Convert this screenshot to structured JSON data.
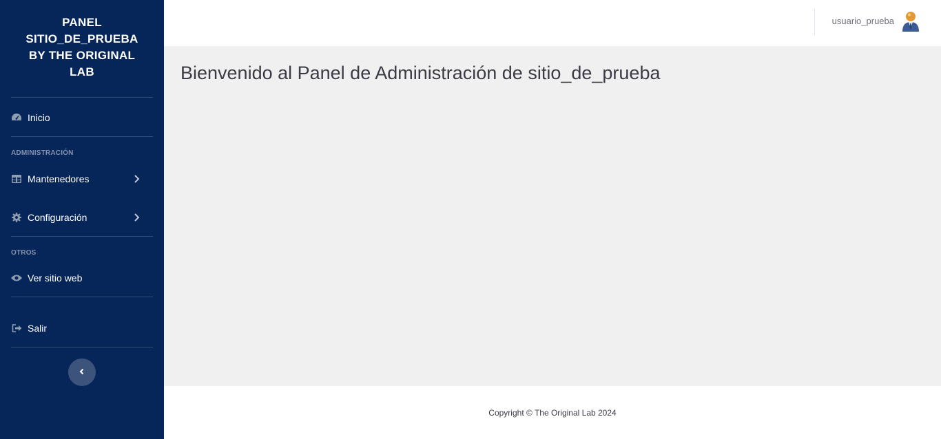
{
  "sidebar": {
    "brand": "PANEL SITIO_DE_PRUEBA BY THE ORIGINAL LAB",
    "items": {
      "inicio": {
        "label": "Inicio",
        "icon": "tachometer-icon"
      },
      "mantenedores": {
        "label": "Mantenedores",
        "icon": "table-icon"
      },
      "configuracion": {
        "label": "Configuración",
        "icon": "gear-icon"
      },
      "ver_sitio": {
        "label": "Ver sitio web",
        "icon": "eye-icon"
      },
      "salir": {
        "label": "Salir",
        "icon": "sign-out-icon"
      }
    },
    "sections": {
      "administracion": "ADMINISTRACIÓN",
      "otros": "OTROS"
    },
    "toggle_icon": "chevron-left-icon"
  },
  "topbar": {
    "user_name": "usuario_prueba",
    "avatar_icon": "user-avatar-icon"
  },
  "main": {
    "title": "Bienvenido al Panel de Administración de sitio_de_prueba"
  },
  "footer": {
    "copyright": "Copyright © The Original Lab 2024"
  },
  "colors": {
    "sidebar_bg": "#062558",
    "content_bg": "#f0f0f0",
    "text_dark": "#3a3b45"
  }
}
